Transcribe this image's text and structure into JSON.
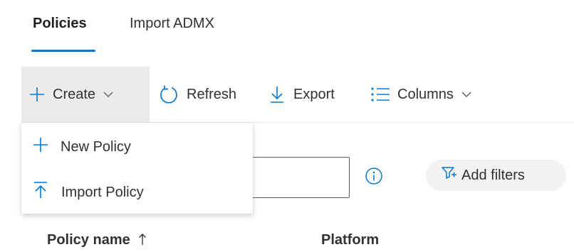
{
  "tabs": [
    {
      "label": "Policies",
      "active": true
    },
    {
      "label": "Import ADMX",
      "active": false
    }
  ],
  "toolbar": {
    "create_label": "Create",
    "refresh_label": "Refresh",
    "export_label": "Export",
    "columns_label": "Columns"
  },
  "create_menu": {
    "items": [
      {
        "label": "New Policy",
        "icon": "plus-icon"
      },
      {
        "label": "Import Policy",
        "icon": "upload-icon"
      }
    ]
  },
  "filters": {
    "search_value": "",
    "add_filters_label": "Add filters"
  },
  "table": {
    "columns": [
      {
        "label": "Policy name",
        "sort": "ascending"
      },
      {
        "label": "Platform"
      }
    ]
  },
  "colors": {
    "accent": "#0078d4",
    "text": "#323130",
    "hover_bg": "#edebe9",
    "pill_bg": "#f3f2f1"
  }
}
